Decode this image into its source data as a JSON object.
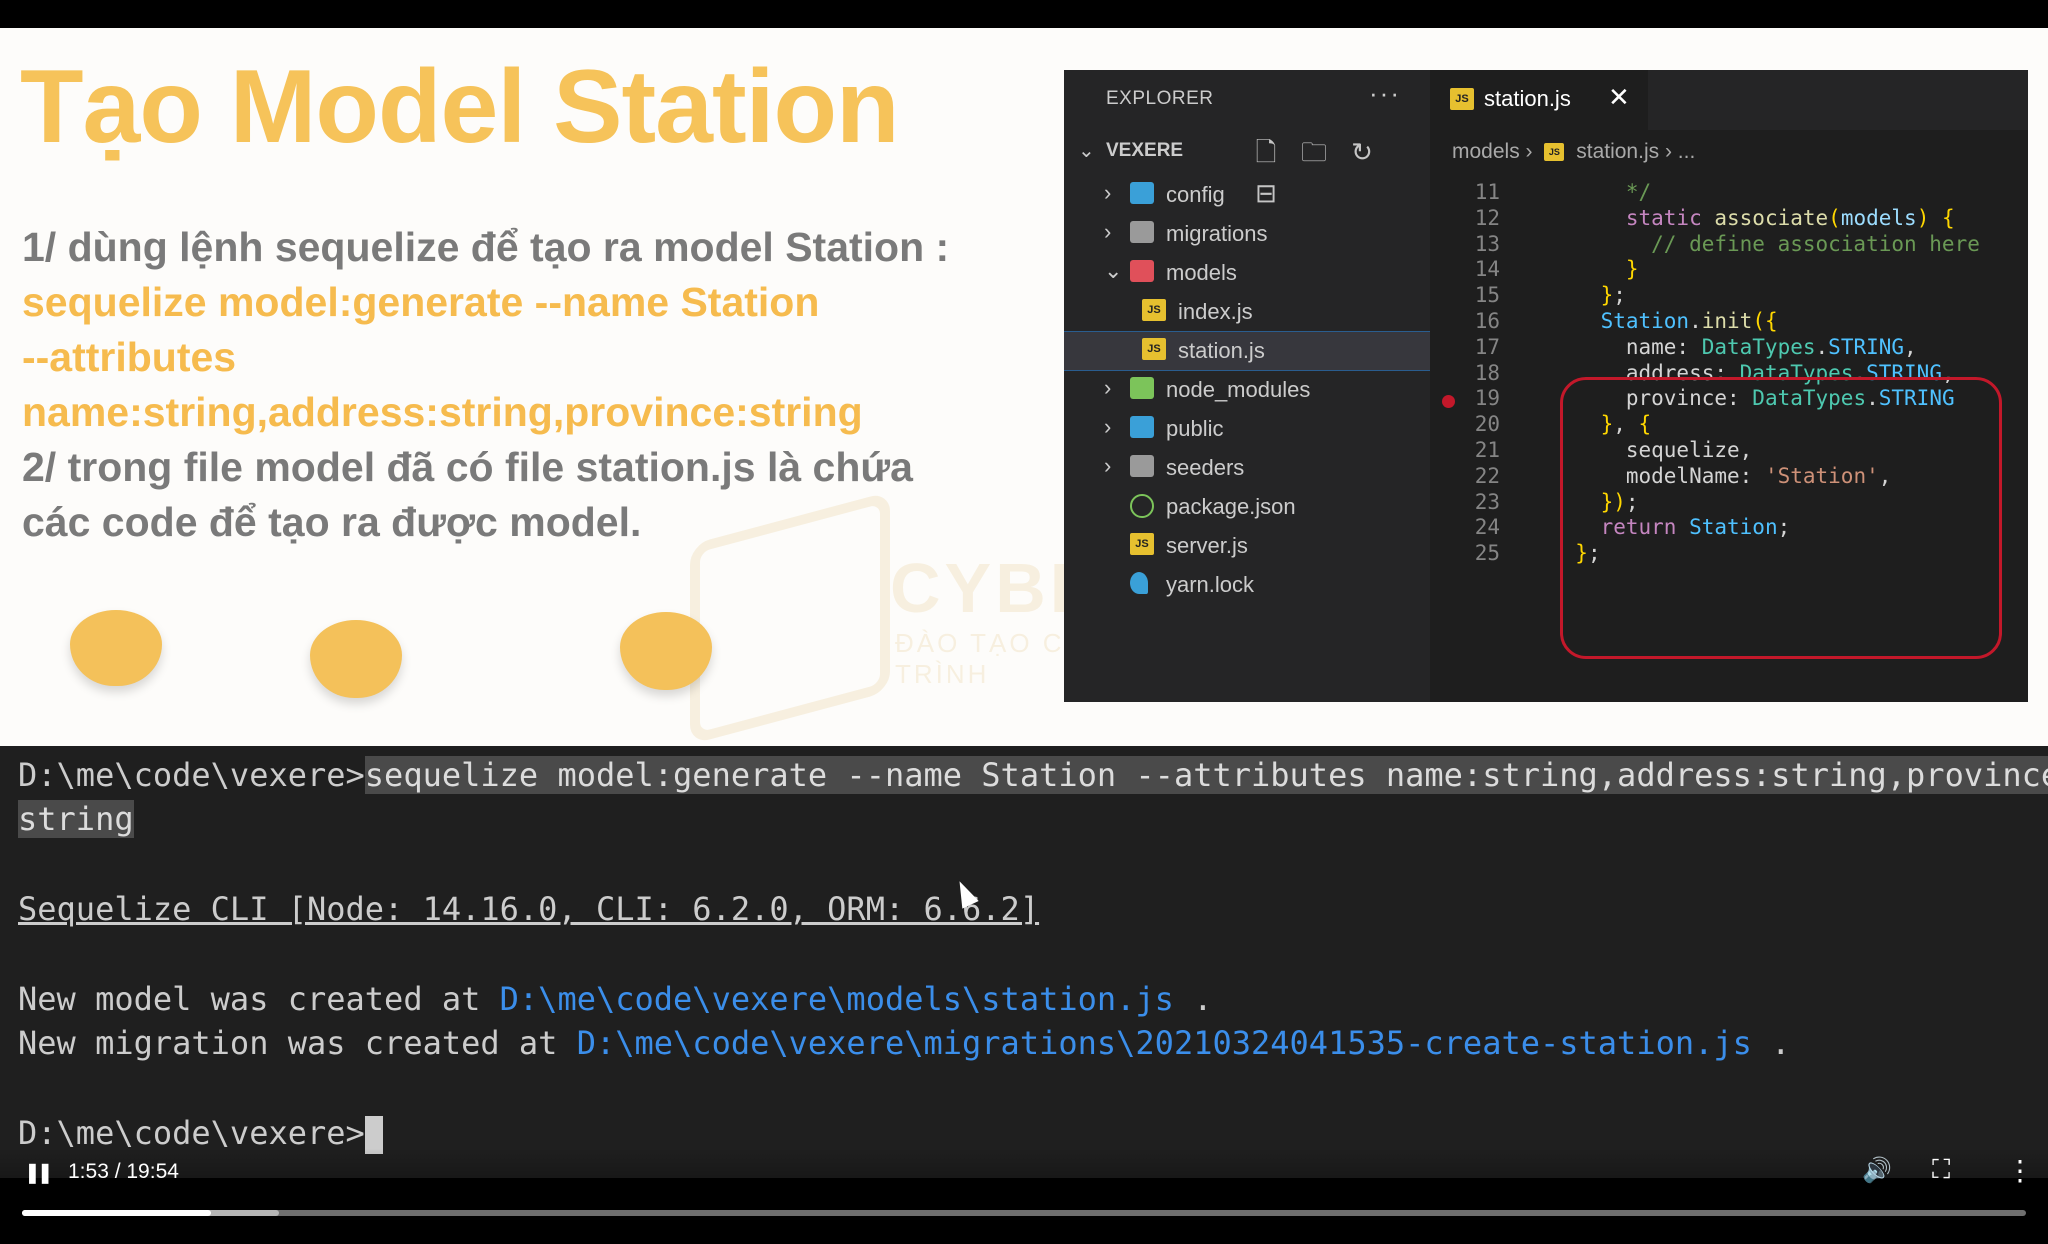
{
  "slide": {
    "title": "Tạo Model Station",
    "step1": "1/ dùng lệnh sequelize để tạo ra model Station :",
    "command_lines": [
      "sequelize model:generate --name Station",
      "--attributes",
      "name:string,address:string,province:string"
    ],
    "step2_lines": [
      "2/ trong file model đã có file station.js là chứa",
      "các code để tạo ra được model."
    ],
    "watermark": "CYBERLEARN",
    "watermark_sub": "ĐÀO TẠO CHUYÊN GIA LẬP TRÌNH"
  },
  "vscode": {
    "explorer_title": "EXPLORER",
    "more_icon": "···",
    "project_name": "VEXERE",
    "tree": [
      {
        "label": "config",
        "icon": "folder-blue",
        "chevron": "›",
        "indent": 0
      },
      {
        "label": "migrations",
        "icon": "folder-gray",
        "chevron": "›",
        "indent": 0
      },
      {
        "label": "models",
        "icon": "folder-red",
        "chevron": "⌄",
        "indent": 0
      },
      {
        "label": "index.js",
        "icon": "js",
        "chevron": "",
        "indent": 1
      },
      {
        "label": "station.js",
        "icon": "js",
        "chevron": "",
        "indent": 1,
        "selected": true
      },
      {
        "label": "node_modules",
        "icon": "folder-green",
        "chevron": "›",
        "indent": 0
      },
      {
        "label": "public",
        "icon": "folder-blue",
        "chevron": "›",
        "indent": 0
      },
      {
        "label": "seeders",
        "icon": "folder-gray",
        "chevron": "›",
        "indent": 0
      },
      {
        "label": "package.json",
        "icon": "npm",
        "chevron": "",
        "indent": 0
      },
      {
        "label": "server.js",
        "icon": "js",
        "chevron": "",
        "indent": 0
      },
      {
        "label": "yarn.lock",
        "icon": "yarn",
        "chevron": "",
        "indent": 0
      }
    ],
    "tab_label": "station.js",
    "tab_close": "✕",
    "js_badge": "JS",
    "breadcrumb": {
      "folder": "models",
      "sep": "›",
      "file": "station.js",
      "tail": "› ..."
    },
    "code_lines": [
      {
        "n": "11",
        "text": "      */"
      },
      {
        "n": "12",
        "text": "      static associate(models) {"
      },
      {
        "n": "13",
        "text": "        // define association here"
      },
      {
        "n": "14",
        "text": "      }"
      },
      {
        "n": "15",
        "text": "    };"
      },
      {
        "n": "16",
        "text": "    Station.init({"
      },
      {
        "n": "17",
        "text": "      name: DataTypes.STRING,"
      },
      {
        "n": "18",
        "text": "      address: DataTypes.STRING,"
      },
      {
        "n": "19",
        "text": "      province: DataTypes.STRING"
      },
      {
        "n": "20",
        "text": "    }, {"
      },
      {
        "n": "21",
        "text": "      sequelize,"
      },
      {
        "n": "22",
        "text": "      modelName: 'Station',"
      },
      {
        "n": "23",
        "text": "    });"
      },
      {
        "n": "24",
        "text": "    return Station;"
      },
      {
        "n": "25",
        "text": "  };"
      }
    ]
  },
  "terminal": {
    "prompt": "D:\\me\\code\\vexere>",
    "command_part1": "sequelize model:generate --name Station --attributes name:string,address:string,province:",
    "command_part2": "string",
    "cli_info": "Sequelize CLI [Node: 14.16.0, CLI: 6.2.0, ORM: 6.6.2]",
    "model_msg": "New model was created at ",
    "model_path": "D:\\me\\code\\vexere\\models\\station.js",
    "migration_msg": "New migration was created at ",
    "migration_path": "D:\\me\\code\\vexere\\migrations\\20210324041535-create-station.js",
    "dot": " .",
    "final_prompt": "D:\\me\\code\\vexere>"
  },
  "player": {
    "time": "1:53 / 19:54",
    "played_fraction": 0.0945,
    "buffered_fraction": 0.128,
    "pause_icon": "❚❚",
    "volume_icon": "🔊",
    "exit_fullscreen_icon": "⛶",
    "more_icon": "⋮"
  }
}
